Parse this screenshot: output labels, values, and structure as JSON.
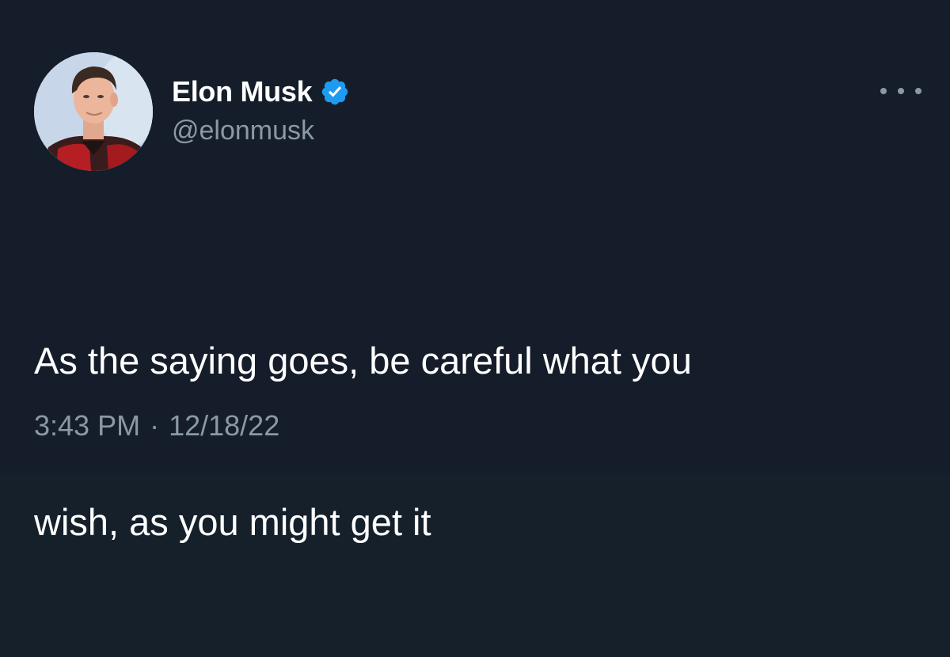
{
  "user": {
    "display_name": "Elon Musk",
    "handle": "@elonmusk",
    "verified": true,
    "avatar_icon": "profile-photo"
  },
  "tweet": {
    "text_lines": [
      "As the saying goes, be careful what you",
      "wish, as you might get it"
    ],
    "time": "3:43 PM",
    "separator": "·",
    "date": "12/18/22"
  },
  "menu": {
    "icon": "more-horizontal-icon"
  },
  "colors": {
    "background": "#151d2a",
    "primary_text": "#ffffff",
    "secondary_text": "#8b98a5",
    "verified_badge": "#1d9bf0"
  }
}
